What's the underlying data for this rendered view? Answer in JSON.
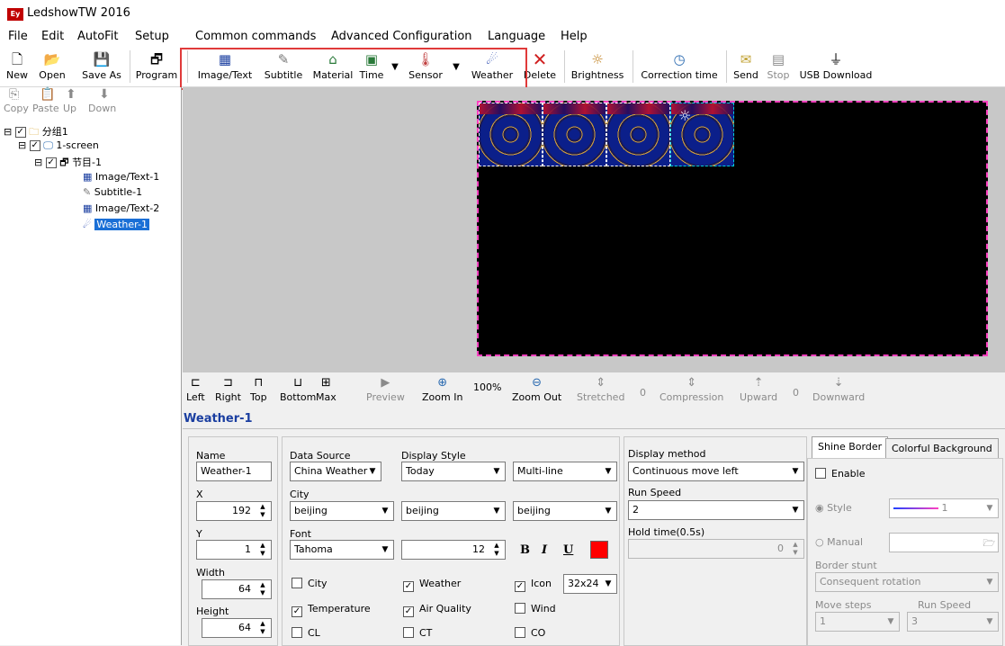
{
  "window": {
    "title": "LedshowTW 2016",
    "logo": "Ey"
  },
  "menu": [
    "File",
    "Edit",
    "AutoFit",
    "Setup",
    "Common commands",
    "Advanced Configuration",
    "Language",
    "Help"
  ],
  "toolbar": {
    "new": "New",
    "open": "Open",
    "save_as": "Save As",
    "program": "Program",
    "image_text": "Image/Text",
    "subtitle": "Subtitle",
    "material": "Material",
    "time": "Time",
    "sensor": "Sensor",
    "weather": "Weather",
    "delete": "Delete",
    "brightness": "Brightness",
    "correction_time": "Correction time",
    "send": "Send",
    "stop": "Stop",
    "usb_download": "USB Download"
  },
  "tree_toolbar": {
    "copy": "Copy",
    "paste": "Paste",
    "up": "Up",
    "down": "Down"
  },
  "tree": {
    "group": "分组1",
    "screen": "1-screen",
    "program": "节目-1",
    "items": [
      "Image/Text-1",
      "Subtitle-1",
      "Image/Text-2",
      "Weather-1"
    ]
  },
  "view_toolbar": {
    "left": "Left",
    "right": "Right",
    "top": "Top",
    "bottom": "Bottom",
    "max": "Max",
    "preview": "Preview",
    "zoom_in": "Zoom In",
    "zoom_level": "100%",
    "zoom_out": "Zoom Out",
    "stretched": "Stretched",
    "stretched_val": "0",
    "compression": "Compression",
    "upward": "Upward",
    "upward_val": "0",
    "downward": "Downward"
  },
  "object_title": "Weather-1",
  "props": {
    "name_label": "Name",
    "name_value": "Weather-1",
    "x_label": "X",
    "x_value": "192",
    "y_label": "Y",
    "y_value": "1",
    "width_label": "Width",
    "width_value": "64",
    "height_label": "Height",
    "height_value": "64",
    "data_source_label": "Data Source",
    "data_source": "China Weather",
    "display_style_label": "Display Style",
    "display_style": "Today",
    "line_mode": "Multi-line",
    "city_label": "City",
    "city1": "beijing",
    "city2": "beijing",
    "city3": "beijing",
    "font_label": "Font",
    "font_value": "Tahoma",
    "font_size": "12",
    "bold": "B",
    "italic": "I",
    "underline": "U",
    "font_color": "#ff0000",
    "checks": {
      "city": "City",
      "weather": "Weather",
      "icon": "Icon",
      "icon_size": "32x24",
      "temperature": "Temperature",
      "air_quality": "Air Quality",
      "wind": "Wind",
      "cl": "CL",
      "ct": "CT",
      "co": "CO"
    },
    "display_method_label": "Display method",
    "display_method": "Continuous move left",
    "run_speed_label": "Run Speed",
    "run_speed": "2",
    "hold_time_label": "Hold time(0.5s)",
    "hold_time": "0"
  },
  "border": {
    "tab_shine": "Shine Border",
    "tab_colorful": "Colorful Background",
    "enable": "Enable",
    "style": "Style",
    "style_value": "1",
    "manual": "Manual",
    "stunt_label": "Border stunt",
    "stunt": "Consequent rotation",
    "move_steps_label": "Move steps",
    "move_steps": "1",
    "run_speed_label": "Run Speed",
    "run_speed": "3"
  }
}
